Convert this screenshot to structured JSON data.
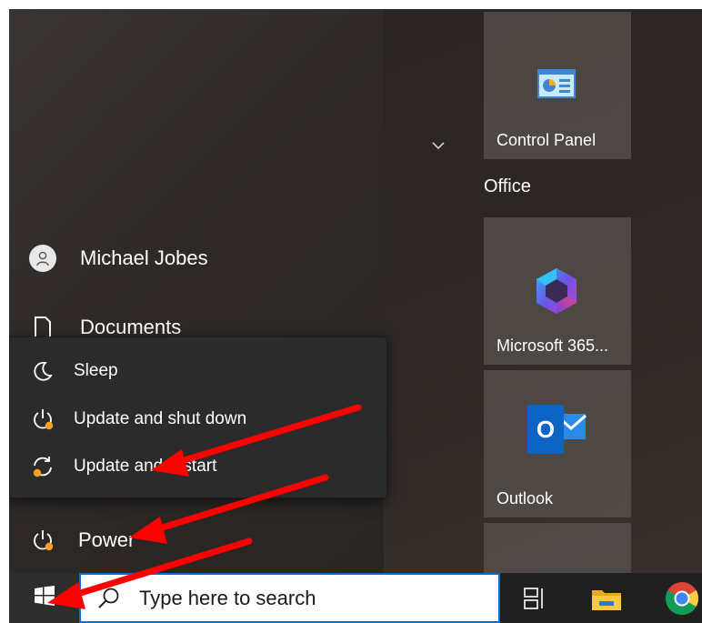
{
  "start_menu": {
    "user": {
      "name": "Michael Jobes",
      "icon": "user-avatar-icon"
    },
    "documents": {
      "label": "Documents",
      "icon": "document-icon"
    },
    "power": {
      "label": "Power",
      "icon": "power-update-icon"
    },
    "expand_icon": "chevron-down-icon"
  },
  "power_menu": {
    "items": [
      {
        "label": "Sleep",
        "icon": "moon-icon"
      },
      {
        "label": "Update and shut down",
        "icon": "power-update-icon"
      },
      {
        "label": "Update and restart",
        "icon": "restart-update-icon"
      }
    ]
  },
  "tiles": {
    "control_panel": {
      "label": "Control Panel",
      "icon": "control-panel-icon"
    },
    "group_label": "Office",
    "microsoft365": {
      "label": "Microsoft 365...",
      "icon": "microsoft-365-icon"
    },
    "outlook": {
      "label": "Outlook",
      "icon": "outlook-icon",
      "glyph": "O"
    }
  },
  "taskbar": {
    "search_placeholder": "Type here to search",
    "start_icon": "windows-logo-icon",
    "search_icon": "search-icon",
    "task_view_icon": "task-view-icon",
    "file_explorer_icon": "file-explorer-icon",
    "chrome_icon": "chrome-icon"
  },
  "colors": {
    "arrow": "#ff0000",
    "update_dot": "#f6a21a",
    "search_border": "#0a6cd8",
    "taskbar": "#202020"
  }
}
